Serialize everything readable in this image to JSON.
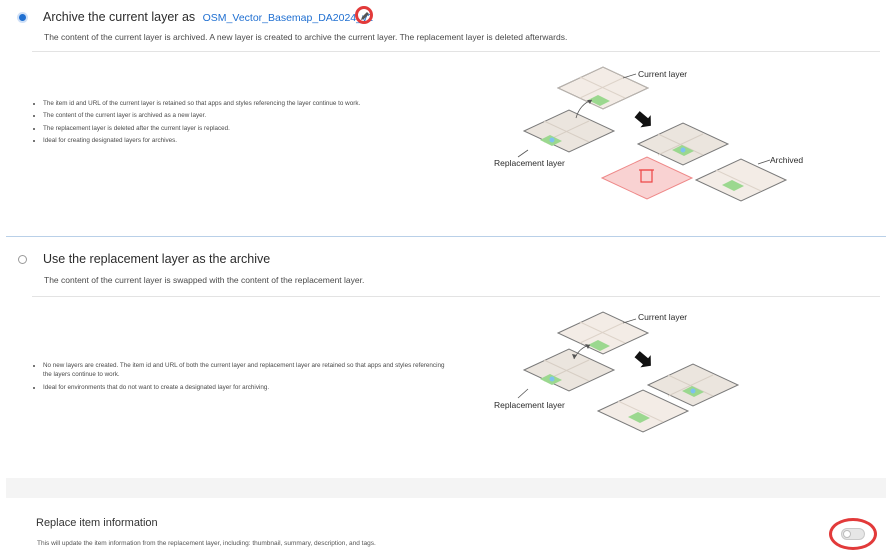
{
  "option_archive": {
    "title": "Archive the current layer as",
    "link_text": "OSM_Vector_Basemap_DA2024_v2",
    "selected": true,
    "description": "The content of the current layer is archived. A new layer is created to archive the current layer. The replacement layer is deleted afterwards.",
    "bullets": [
      "The item id and URL of the current layer is retained so that apps and styles referencing the layer continue to work.",
      "The content of the current layer is archived as a new layer.",
      "The replacement layer is deleted after the current layer is replaced.",
      "Ideal for creating designated layers for archives."
    ],
    "diagram": {
      "current_label": "Current layer",
      "replacement_label": "Replacement layer",
      "archived_label": "Archived"
    }
  },
  "option_swap": {
    "title": "Use the replacement layer as the archive",
    "selected": false,
    "description": "The content of the current layer is swapped with the content of the replacement layer.",
    "bullets": [
      "No new layers are created. The item id and URL of both the current layer and replacement layer are retained so that apps and styles referencing the layers continue to work.",
      "Ideal for environments that do not want to create a designated layer for archiving."
    ],
    "diagram": {
      "current_label": "Current layer",
      "replacement_label": "Replacement layer"
    }
  },
  "replace_info": {
    "title": "Replace item information",
    "description": "This will update the item information from the replacement layer, including: thumbnail, summary, description, and tags.",
    "toggle_on": false
  },
  "colors": {
    "accent": "#1f6fd1",
    "highlight_ring": "#e23a3a",
    "layer_fill": "#f3ece6",
    "layer_green": "#9bd88f",
    "delete_fill": "#f9d2d2"
  }
}
